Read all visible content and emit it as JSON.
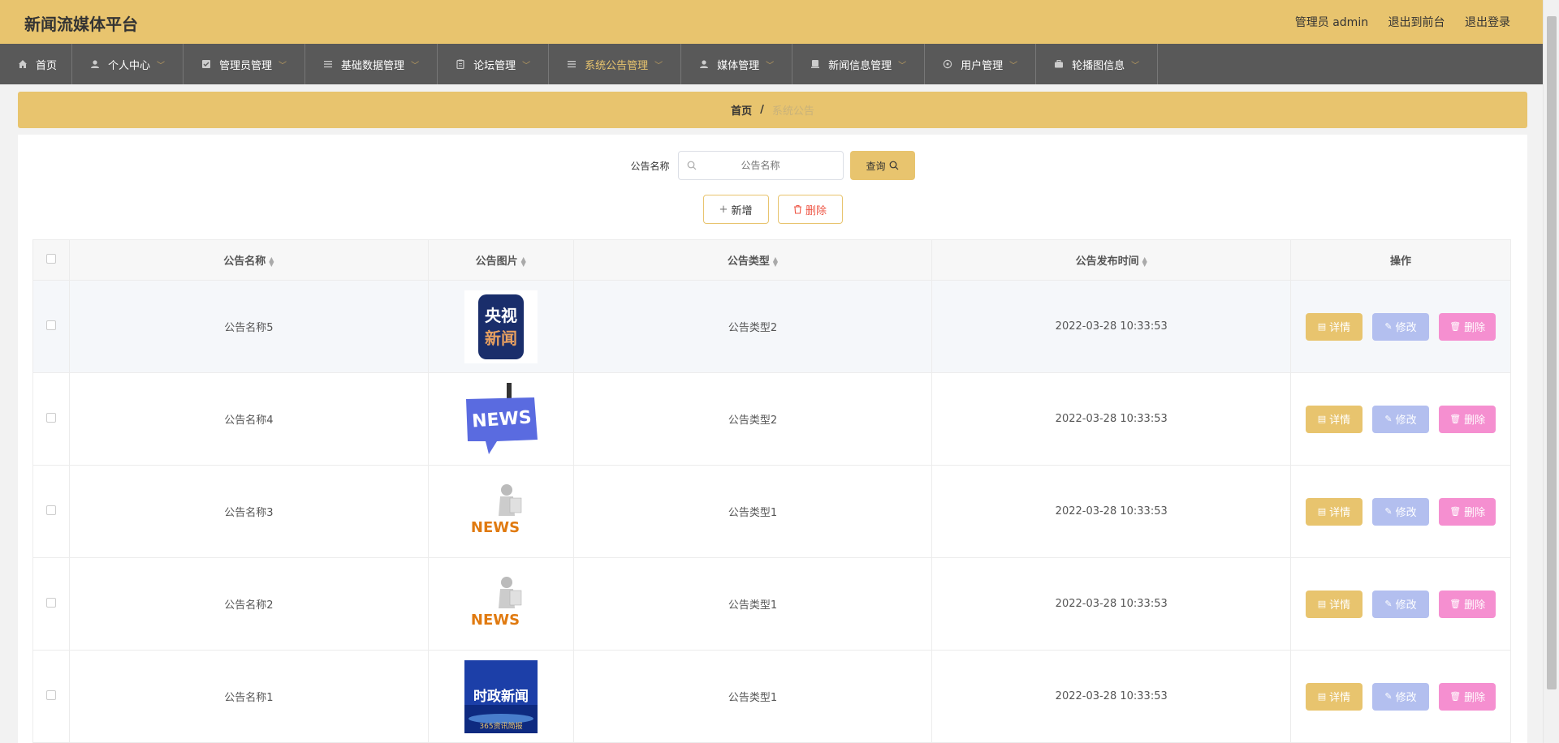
{
  "app": {
    "title": "新闻流媒体平台"
  },
  "top_links": {
    "admin": "管理员 admin",
    "front": "退出到前台",
    "logout": "退出登录"
  },
  "nav": [
    {
      "label": "首页",
      "icon": "home-icon",
      "dropdown": false
    },
    {
      "label": "个人中心",
      "icon": "user-icon",
      "dropdown": true
    },
    {
      "label": "管理员管理",
      "icon": "check-icon",
      "dropdown": true
    },
    {
      "label": "基础数据管理",
      "icon": "menu-icon",
      "dropdown": true
    },
    {
      "label": "论坛管理",
      "icon": "clipboard-icon",
      "dropdown": true
    },
    {
      "label": "系统公告管理",
      "icon": "menu-icon",
      "dropdown": true,
      "active": true
    },
    {
      "label": "媒体管理",
      "icon": "user-icon",
      "dropdown": true
    },
    {
      "label": "新闻信息管理",
      "icon": "device-icon",
      "dropdown": true
    },
    {
      "label": "用户管理",
      "icon": "gear-icon",
      "dropdown": true
    },
    {
      "label": "轮播图信息",
      "icon": "briefcase-icon",
      "dropdown": true
    }
  ],
  "breadcrumb": {
    "home": "首页",
    "sep": "/",
    "current": "系统公告"
  },
  "search": {
    "label": "公告名称",
    "placeholder": "公告名称",
    "button": "查询"
  },
  "actions": {
    "add": "新增",
    "delete": "删除"
  },
  "table": {
    "headers": {
      "name": "公告名称",
      "image": "公告图片",
      "type": "公告类型",
      "time": "公告发布时间",
      "ops": "操作"
    },
    "rows": [
      {
        "name": "公告名称5",
        "image": "cctv-news-logo",
        "type": "公告类型2",
        "time": "2022-03-28 10:33:53"
      },
      {
        "name": "公告名称4",
        "image": "news-sign-image",
        "type": "公告类型2",
        "time": "2022-03-28 10:33:53"
      },
      {
        "name": "公告名称3",
        "image": "news-figure-image",
        "type": "公告类型1",
        "time": "2022-03-28 10:33:53"
      },
      {
        "name": "公告名称2",
        "image": "news-figure-image",
        "type": "公告类型1",
        "time": "2022-03-28 10:33:53"
      },
      {
        "name": "公告名称1",
        "image": "politics-news-image",
        "type": "公告类型1",
        "time": "2022-03-28 10:33:53"
      }
    ],
    "ops": {
      "detail": "详情",
      "edit": "修改",
      "delete": "删除"
    }
  },
  "thumb_text": {
    "cctv": "央视新闻",
    "cctv_top": "央视",
    "cctv_bottom": "新闻",
    "sign": "NEWS",
    "figure": "NEWS",
    "politics": "时政新闻",
    "politics_sub": "365资讯简报"
  },
  "colors": {
    "accent": "#e8c46e",
    "nav_bg": "#595959",
    "edit": "#b3bfef",
    "delete": "#f58fd0"
  }
}
